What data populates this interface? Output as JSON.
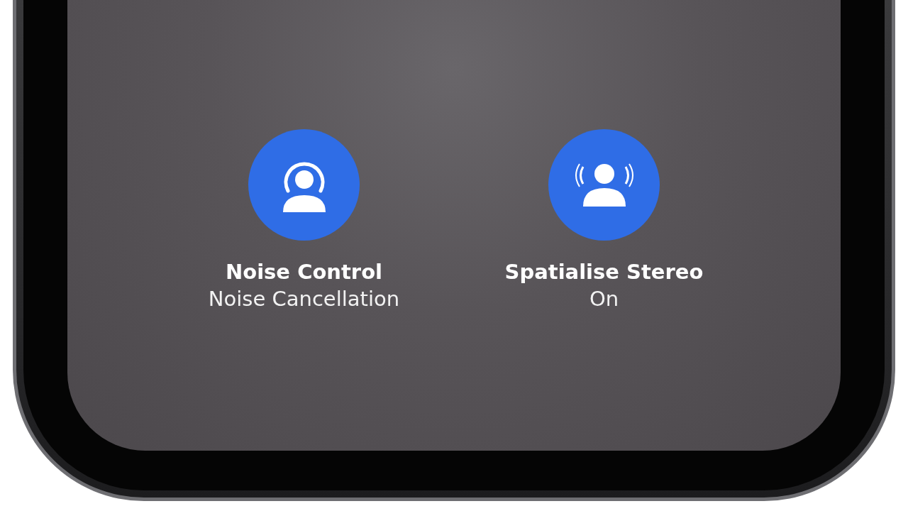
{
  "controls": [
    {
      "kind": "noise",
      "title": "Noise Control",
      "value": "Noise Cancellation",
      "on": true
    },
    {
      "kind": "spatial",
      "title": "Spatialise Stereo",
      "value": "On",
      "on": true
    }
  ]
}
